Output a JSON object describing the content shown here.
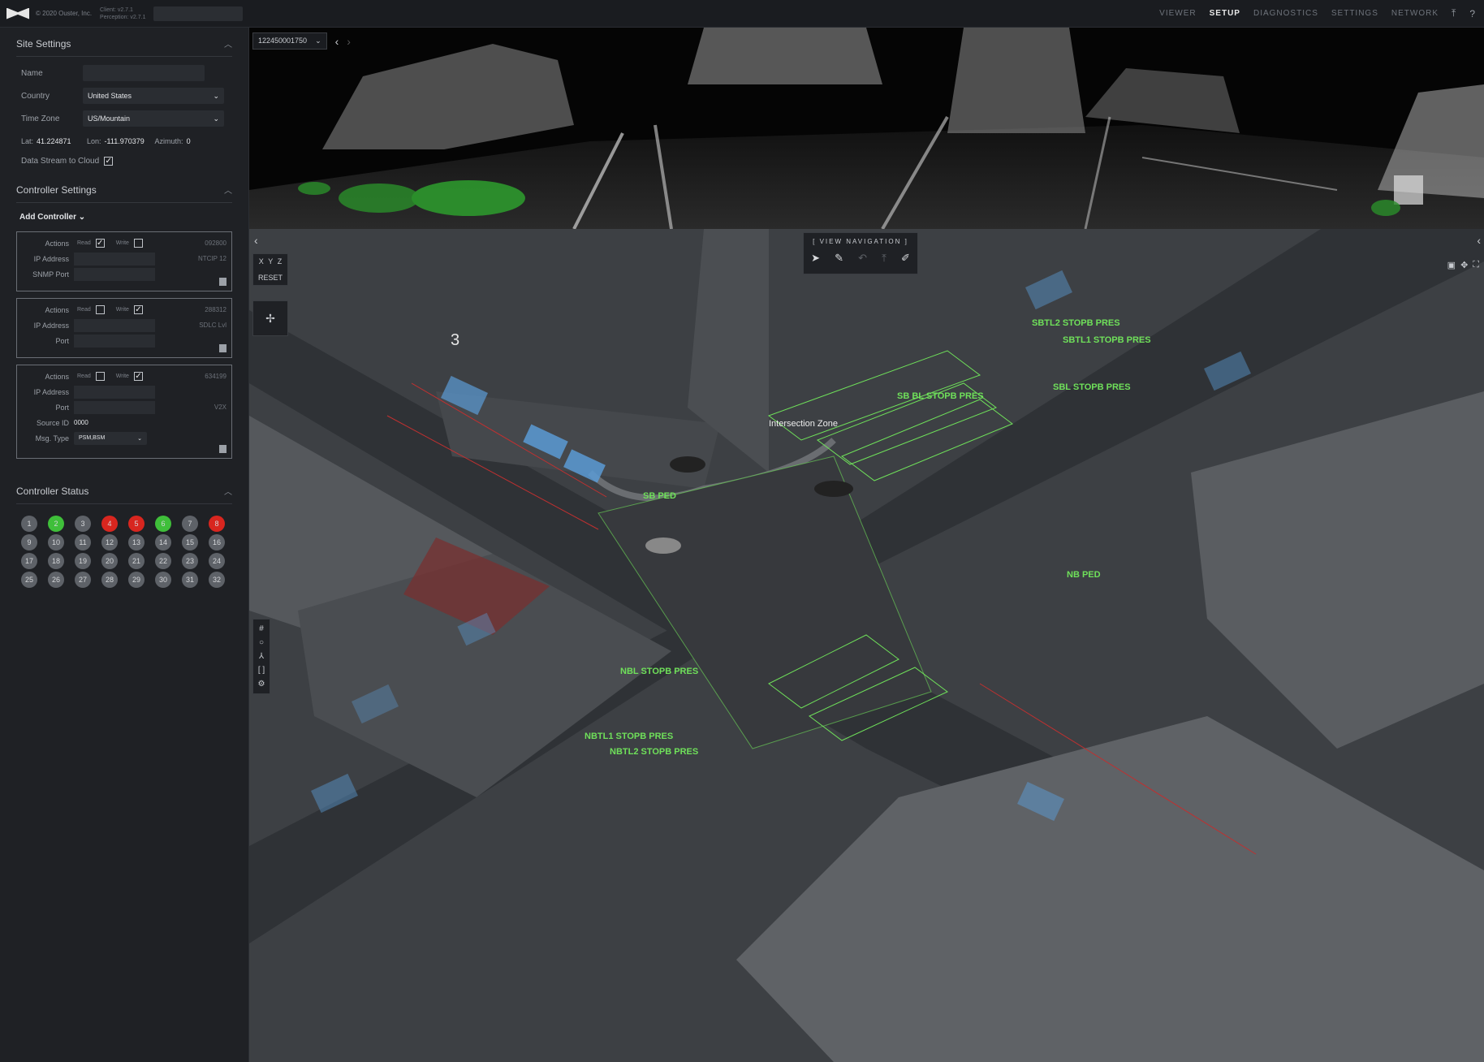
{
  "topbar": {
    "brand": "© 2020 Ouster, Inc.",
    "version_client": "Client: v2.7.1",
    "version_perception": "Perception: v2.7.1",
    "nav": [
      "VIEWER",
      "SETUP",
      "DIAGNOSTICS",
      "SETTINGS",
      "NETWORK"
    ],
    "active_nav": "SETUP"
  },
  "site_settings": {
    "title": "Site Settings",
    "name_label": "Name",
    "country_label": "Country",
    "country_value": "United States",
    "timezone_label": "Time Zone",
    "timezone_value": "US/Mountain",
    "lat_label": "Lat:",
    "lat_value": "41.224871",
    "lon_label": "Lon:",
    "lon_value": "-111.970379",
    "azimuth_label": "Azimuth:",
    "azimuth_value": "0",
    "stream_label": "Data Stream to Cloud"
  },
  "controller_settings": {
    "title": "Controller Settings",
    "add_label": "Add Controller ⌄",
    "actions_label": "Actions",
    "read_label": "Read",
    "write_label": "Write",
    "ip_label": "IP Address",
    "cards": [
      {
        "read": true,
        "write": false,
        "id": "092800",
        "protocol": "NTCIP 12",
        "port_label": "SNMP Port"
      },
      {
        "read": false,
        "write": true,
        "id": "288312",
        "protocol": "SDLC Lvl",
        "port_label": "Port"
      },
      {
        "read": false,
        "write": true,
        "id": "634199",
        "protocol": "V2X",
        "port_label": "Port",
        "source_label": "Source ID",
        "source_value": "0000",
        "msg_label": "Msg. Type",
        "msg_value": "PSM,BSM"
      }
    ]
  },
  "controller_status": {
    "title": "Controller Status",
    "numbers": [
      "1",
      "2",
      "3",
      "4",
      "5",
      "6",
      "7",
      "8",
      "9",
      "10",
      "11",
      "12",
      "13",
      "14",
      "15",
      "16",
      "17",
      "18",
      "19",
      "20",
      "21",
      "22",
      "23",
      "24",
      "25",
      "26",
      "27",
      "28",
      "29",
      "30",
      "31",
      "32"
    ],
    "states": [
      "gray",
      "green",
      "gray",
      "red",
      "red",
      "green",
      "gray",
      "red",
      "gray",
      "gray",
      "gray",
      "gray",
      "gray",
      "gray",
      "gray",
      "gray",
      "gray",
      "gray",
      "gray",
      "gray",
      "gray",
      "gray",
      "gray",
      "gray",
      "gray",
      "gray",
      "gray",
      "gray",
      "gray",
      "gray",
      "gray",
      "gray"
    ]
  },
  "lidar_view": {
    "sensor_id": "122450001750"
  },
  "view_navigation": {
    "title": "[ VIEW NAVIGATION ]"
  },
  "map_controls": {
    "axes": [
      "X",
      "Y",
      "Z"
    ],
    "reset": "RESET"
  },
  "map_labels": {
    "zone_count": "3",
    "intersection_zone": "Intersection Zone",
    "sbtl2": "SBTL2 STOPB PRES",
    "sbtl1": "SBTL1 STOPB PRES",
    "sb_bl": "SB BL STOPB PRES",
    "sbl": "SBL STOPB PRES",
    "sb_ped": "SB PED",
    "nb_ped": "NB PED",
    "nbl": "NBL STOPB PRES",
    "nbtl1": "NBTL1 STOPB PRES",
    "nbtl2": "NBTL2 STOPB PRES"
  }
}
